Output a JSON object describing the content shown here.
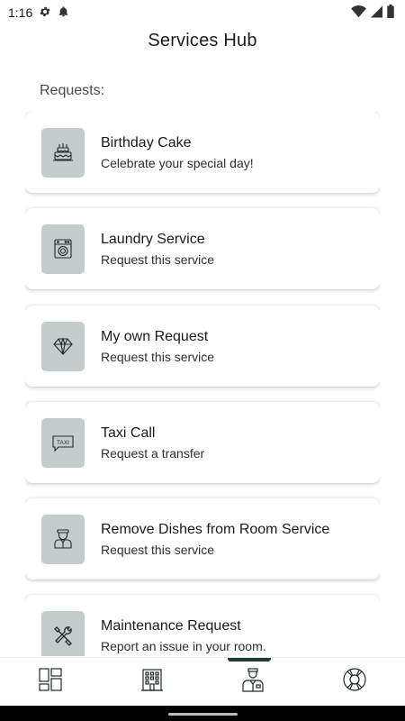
{
  "status_bar": {
    "time": "1:16",
    "icons_left": [
      "gear-icon",
      "notification-bell-icon"
    ],
    "icons_right": [
      "wifi-icon",
      "cell-signal-icon",
      "battery-icon"
    ]
  },
  "header": {
    "title": "Services Hub"
  },
  "section": {
    "label": "Requests:"
  },
  "requests": [
    {
      "icon": "cake-icon",
      "title": "Birthday Cake",
      "subtitle": "Celebrate your special day!"
    },
    {
      "icon": "washing-machine-icon",
      "title": "Laundry Service",
      "subtitle": "Request this service"
    },
    {
      "icon": "diamond-icon",
      "title": "My own Request",
      "subtitle": "Request this service"
    },
    {
      "icon": "taxi-icon",
      "title": "Taxi Call",
      "subtitle": "Request a transfer",
      "icon_text": "TAXI"
    },
    {
      "icon": "waiter-icon",
      "title": "Remove Dishes from Room Service",
      "subtitle": "Request this service"
    },
    {
      "icon": "tools-icon",
      "title": "Maintenance Request",
      "subtitle": "Report an issue in your room."
    }
  ],
  "bottom_nav": [
    {
      "icon": "dashboard-icon",
      "active": false
    },
    {
      "icon": "hotel-building-icon",
      "active": false
    },
    {
      "icon": "concierge-person-icon",
      "active": true
    },
    {
      "icon": "lifebuoy-icon",
      "active": false
    }
  ],
  "colors": {
    "icon_tile": "#c4cdcb",
    "active_indicator": "#1e3b34",
    "icon_stroke": "#1f2a28"
  }
}
